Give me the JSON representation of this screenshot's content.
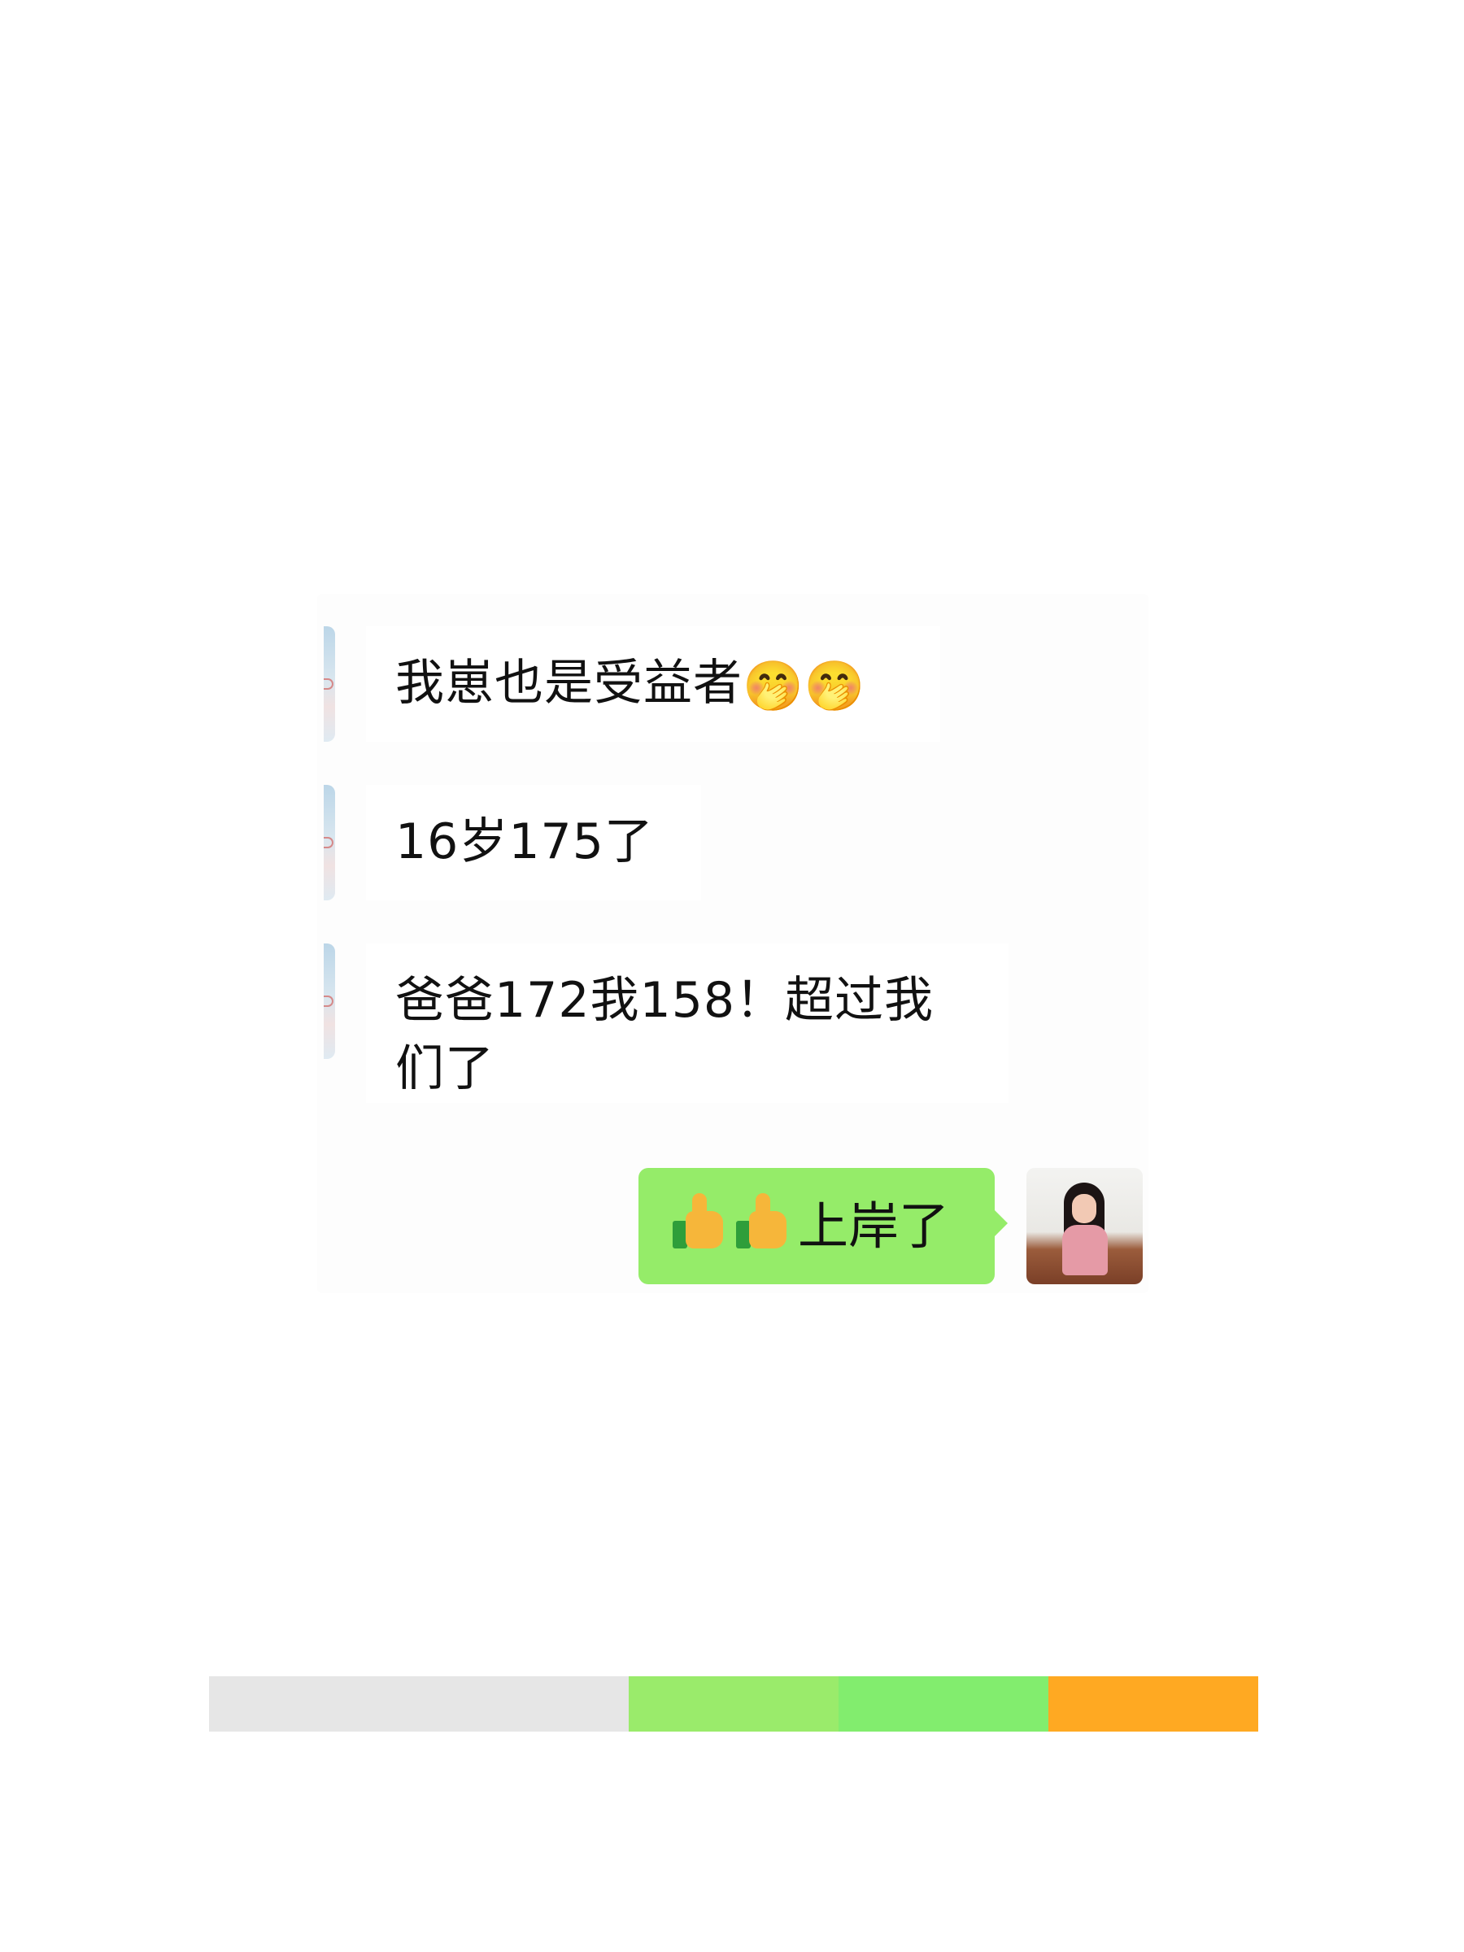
{
  "messages_in": [
    {
      "text": "我崽也是受益者",
      "emojis": [
        "🤭",
        "🤭"
      ]
    },
    {
      "text": "16岁175了",
      "emojis": []
    },
    {
      "text": "爸爸172我158！超过我们了",
      "line1": "爸爸172我158！超过我",
      "line2": "们了",
      "emojis": []
    }
  ],
  "message_out": {
    "text": "上岸了",
    "emojis": [
      "thumbs-up-icon",
      "thumbs-up-icon"
    ]
  },
  "colors": {
    "bubble_out": "#95ec69",
    "bubble_in": "#ffffff",
    "color_bar": [
      "#e6e6e6",
      "#9aeb6b",
      "#82ed6e",
      "#ffa922"
    ]
  }
}
